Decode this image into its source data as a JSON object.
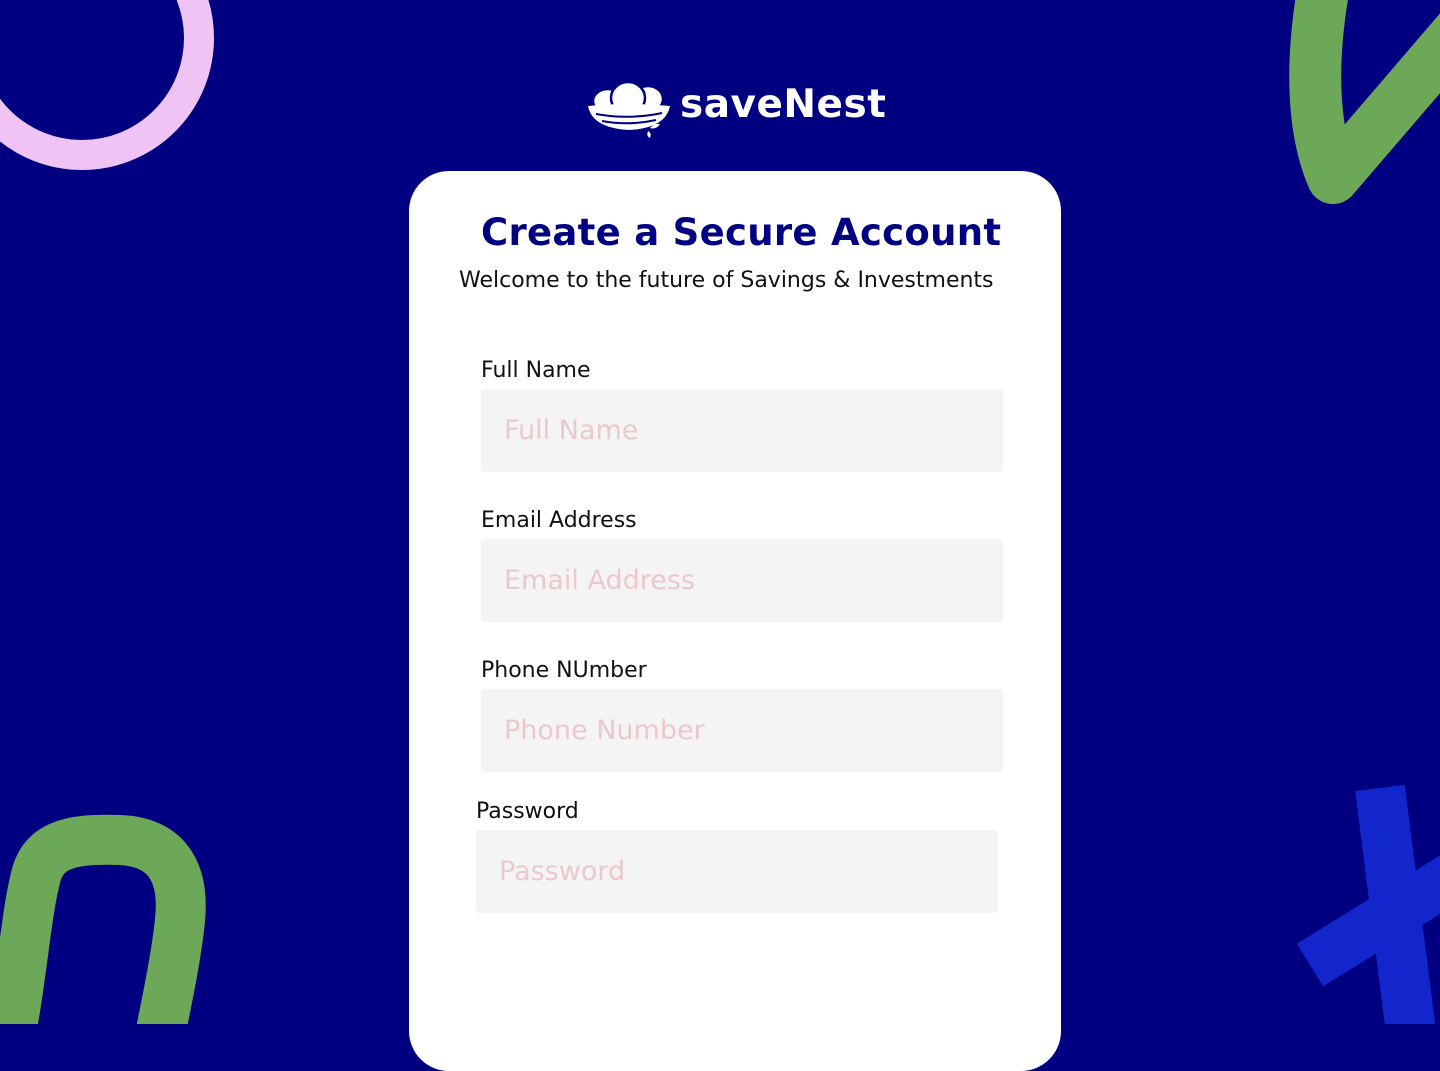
{
  "brand": {
    "name": "saveNest",
    "logo_icon": "nest-eggs-icon"
  },
  "form": {
    "title": "Create a Secure Account",
    "subtitle": "Welcome to the future of Savings & Investments",
    "fields": [
      {
        "label": "Full Name",
        "placeholder": "Full Name",
        "value": ""
      },
      {
        "label": "Email Address",
        "placeholder": "Email Address",
        "value": ""
      },
      {
        "label": "Phone NUmber",
        "placeholder": "Phone Number",
        "value": ""
      },
      {
        "label": "Password",
        "placeholder": "Password",
        "value": ""
      }
    ]
  },
  "colors": {
    "background": "#000080",
    "card": "#ffffff",
    "title": "#000080",
    "input_background": "#f4f4f4",
    "placeholder": "#ebc8cc",
    "decor_pink": "#efc4f5",
    "decor_green": "#6ca858",
    "decor_blue": "#1226cc"
  }
}
